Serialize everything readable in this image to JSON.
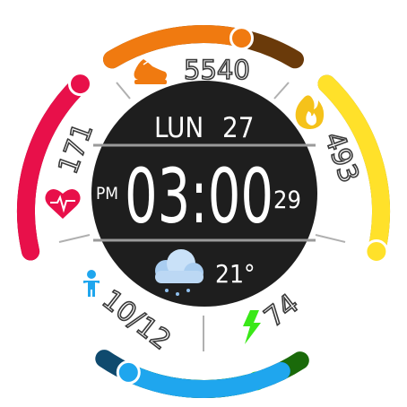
{
  "watchface": {
    "date": {
      "weekday": "LUN",
      "day": "27"
    },
    "time": {
      "hh_mm": "03:00",
      "seconds": "29",
      "ampm": "PM"
    },
    "weather": {
      "icon": "cloud-rain-icon",
      "temperature": "21°"
    },
    "steps": {
      "value": "5540",
      "icon": "shoe-icon",
      "progress": 0.7,
      "color": "#f07a10",
      "track_color": "#6a3a0a"
    },
    "calories": {
      "value": "493",
      "icon": "flame-icon",
      "progress": 1.0,
      "color": "#ffe12a",
      "track_color": "#8a7a10"
    },
    "heart_rate": {
      "value": "171",
      "icon": "heart-pulse-icon",
      "progress": 1.0,
      "color": "#e8104a",
      "track_color": "#7a0a26"
    },
    "floors": {
      "value": "10/12",
      "icon": "person-icon",
      "progress": 0.85,
      "color": "#1fa6ee",
      "track_color": "#0f4a6e"
    },
    "battery": {
      "value": "74",
      "icon": "lightning-icon",
      "progress": 0.74,
      "color": "#3ae818",
      "track_color": "#1a6a0a"
    },
    "colors": {
      "face_bg": "#1e1e1e",
      "divider": "#9a9a9a",
      "tick": "#b0b0b0"
    }
  }
}
